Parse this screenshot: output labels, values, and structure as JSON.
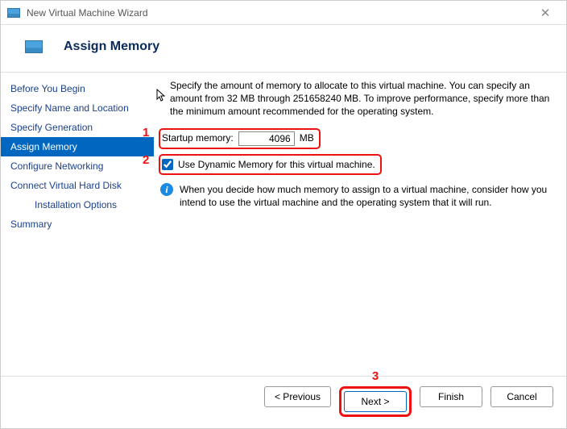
{
  "window": {
    "title": "New Virtual Machine Wizard"
  },
  "header": {
    "title": "Assign Memory"
  },
  "sidebar": {
    "items": [
      {
        "label": "Before You Begin",
        "selected": false
      },
      {
        "label": "Specify Name and Location",
        "selected": false
      },
      {
        "label": "Specify Generation",
        "selected": false
      },
      {
        "label": "Assign Memory",
        "selected": true
      },
      {
        "label": "Configure Networking",
        "selected": false
      },
      {
        "label": "Connect Virtual Hard Disk",
        "selected": false
      },
      {
        "label": "Installation Options",
        "selected": false,
        "indent": true
      },
      {
        "label": "Summary",
        "selected": false
      }
    ]
  },
  "content": {
    "intro": "Specify the amount of memory to allocate to this virtual machine. You can specify an amount from 32 MB through 251658240 MB. To improve performance, specify more than the minimum amount recommended for the operating system.",
    "startup_label": "Startup memory:",
    "startup_value": "4096",
    "startup_unit": "MB",
    "dynamic_checked": true,
    "dynamic_label": "Use Dynamic Memory for this virtual machine.",
    "info_text": "When you decide how much memory to assign to a virtual machine, consider how you intend to use the virtual machine and the operating system that it will run."
  },
  "callouts": {
    "c1": "1",
    "c2": "2",
    "c3": "3"
  },
  "footer": {
    "previous": "< Previous",
    "next": "Next >",
    "finish": "Finish",
    "cancel": "Cancel"
  }
}
